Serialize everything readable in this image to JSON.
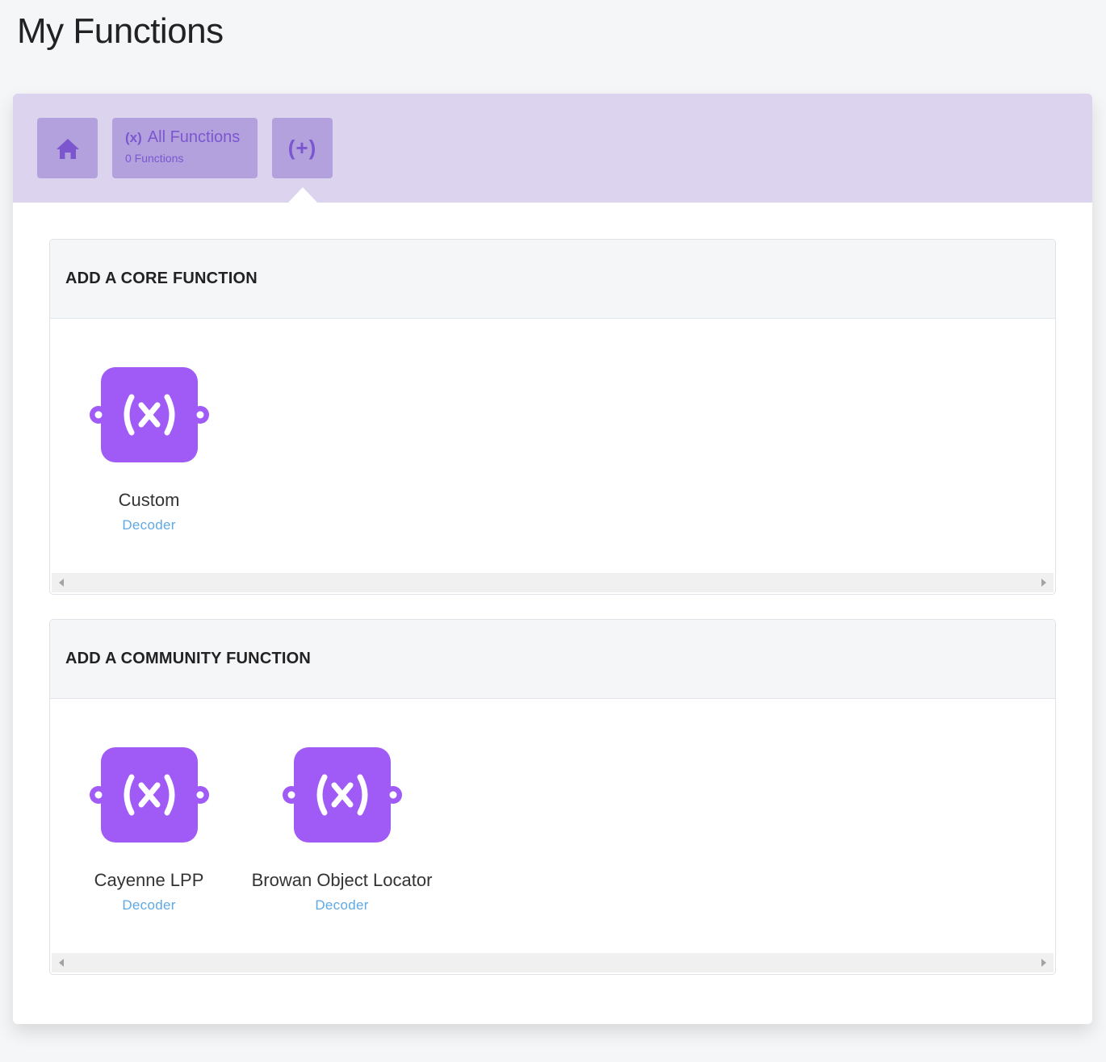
{
  "page": {
    "title": "My Functions"
  },
  "tabs": {
    "home_icon": "home-icon",
    "all_functions": {
      "icon": "function-icon",
      "icon_glyph": "(x)",
      "label": "All Functions",
      "count": "0 Functions"
    },
    "add": {
      "icon": "add-function-icon",
      "glyph": "(+)"
    }
  },
  "sections": {
    "core": {
      "title": "ADD A CORE FUNCTION",
      "items": [
        {
          "name": "Custom",
          "type": "Decoder",
          "icon": "function-icon"
        }
      ]
    },
    "community": {
      "title": "ADD A COMMUNITY FUNCTION",
      "items": [
        {
          "name": "Cayenne LPP",
          "type": "Decoder",
          "icon": "function-icon"
        },
        {
          "name": "Browan Object Locator",
          "type": "Decoder",
          "icon": "function-icon"
        }
      ]
    }
  },
  "colors": {
    "accent_purple": "#a05af5",
    "tab_bar": "#dcd3ee",
    "tab": "#b3a1de",
    "link_blue": "#5fa9e6"
  }
}
